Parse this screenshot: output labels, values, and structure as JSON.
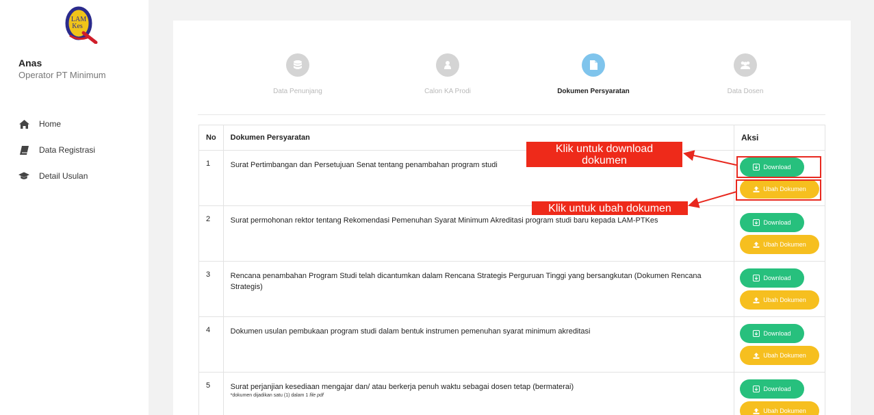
{
  "sidebar": {
    "logo_text_top": "LAM",
    "logo_text_bottom": "Kes",
    "user_name": "Anas",
    "user_role": "Operator PT Minimum",
    "nav": [
      {
        "label": "Home",
        "icon": "home-icon"
      },
      {
        "label": "Data Registrasi",
        "icon": "book-icon"
      },
      {
        "label": "Detail Usulan",
        "icon": "graduation-cap-icon"
      }
    ]
  },
  "steps": [
    {
      "label": "Data Penunjang",
      "icon": "database-icon",
      "active": false
    },
    {
      "label": "Calon KA Prodi",
      "icon": "user-icon",
      "active": false
    },
    {
      "label": "Dokumen Persyaratan",
      "icon": "file-icon",
      "active": true
    },
    {
      "label": "Data Dosen",
      "icon": "users-icon",
      "active": false
    }
  ],
  "table": {
    "headers": {
      "no": "No",
      "doc": "Dokumen Persyaratan",
      "aksi": "Aksi"
    },
    "rows": [
      {
        "no": "1",
        "text": "Surat Pertimbangan dan Persetujuan Senat tentang penambahan program studi",
        "note": ""
      },
      {
        "no": "2",
        "text": "Surat permohonan rektor tentang Rekomendasi Pemenuhan Syarat Minimum Akreditasi program studi baru kepada LAM-PTKes",
        "note": ""
      },
      {
        "no": "3",
        "text": "Rencana penambahan Program Studi telah dicantumkan dalam Rencana Strategis Perguruan Tinggi yang bersangkutan (Dokumen Rencana Strategis)",
        "note": ""
      },
      {
        "no": "4",
        "text": "Dokumen usulan pembukaan program studi dalam bentuk instrumen pemenuhan syarat minimum akreditasi",
        "note": ""
      },
      {
        "no": "5",
        "text": "Surat perjanjian kesediaan mengajar dan/ atau berkerja penuh waktu sebagai dosen tetap (bermaterai)",
        "note": "*dokumen dijadikan satu (1) dalam 1 ",
        "note_em": "file pdf"
      }
    ],
    "download_label": "Download",
    "upload_label": "Ubah Dokumen"
  },
  "annotations": {
    "download_line1": "Klik untuk download",
    "download_line2": "dokumen",
    "upload": "Klik untuk ubah dokumen",
    "color": "#ee2a1a"
  },
  "colors": {
    "download": "#27c07d",
    "upload": "#f6bf1f",
    "step_active": "#7fc4ec",
    "step_inactive": "#d4d4d4"
  }
}
